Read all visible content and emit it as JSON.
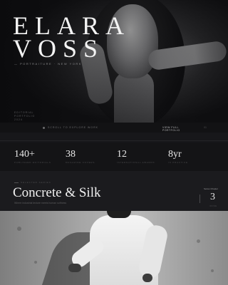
{
  "hero": {
    "first_name": "ELARA",
    "last_name": "VOSS",
    "tagline": "— PORTRAITURE · NEW YORK",
    "meta_line1": "EDITORIAL",
    "meta_line2": "PORTFOLIO",
    "meta_line3": "2024"
  },
  "nav": {
    "left_text": "SCROLL TO EXPLORE WORK",
    "link_label": "VIEW FULL PORTFOLIO",
    "right_text": "01"
  },
  "stats": [
    {
      "value": "140+",
      "label": "PUBLISHED EDITORIALS"
    },
    {
      "value": "38",
      "label": "MAGAZINE COVERS"
    },
    {
      "value": "12",
      "label": "INTERNATIONAL AWARDS"
    },
    {
      "value": "8yr",
      "label": "IN PRACTICE"
    }
  ],
  "section": {
    "kicker": "SELECTED SERIES",
    "title": "Concrete & Silk",
    "subtitle": "Where industrial texture meets human softness",
    "count_label": "Series Chapter",
    "count_value": "3",
    "count_caption": "OF FIVE"
  }
}
